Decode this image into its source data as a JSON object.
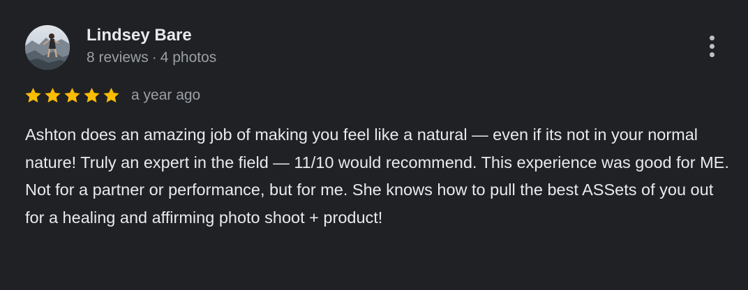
{
  "reviewer": {
    "name": "Lindsey Bare",
    "reviews_count": "8 reviews",
    "separator": "·",
    "photos_count": "4 photos",
    "avatar_icon": "avatar-photo"
  },
  "menu": {
    "icon": "more-vertical-icon"
  },
  "rating": {
    "stars": 5,
    "max_stars": 5,
    "star_color": "#fbbc04",
    "date": "a year ago"
  },
  "review": {
    "text": "Ashton does an amazing job of making you feel like a natural — even if its not in your normal nature! Truly an expert in the field — 11/10 would recommend. This experience was good for ME. Not for a partner or performance, but for me. She knows how to pull the best ASSets of you out for a healing and affirming photo shoot + product!"
  },
  "theme": {
    "background": "#202124",
    "text_primary": "#e8eaed",
    "text_secondary": "#9aa0a6"
  }
}
